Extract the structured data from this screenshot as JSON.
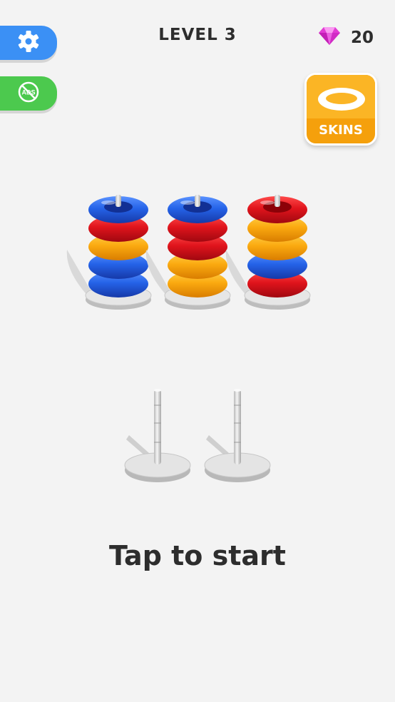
{
  "header": {
    "level": "LEVEL 3",
    "gem_count": "20",
    "gem_icon": "gem-icon"
  },
  "side_buttons": {
    "settings_icon": "gear-icon",
    "no_ads_icon": "no-ads-icon",
    "no_ads_text": "ADS"
  },
  "skins_button": {
    "label": "SKINS",
    "icon": "ring-icon"
  },
  "colors": {
    "blue": "#2563e8",
    "red": "#e0141c",
    "yellow": "#fbaa10",
    "settings_button": "#3b90f5",
    "no_ads_button": "#4cc94e",
    "skins_button": "#f5a00c"
  },
  "towers": [
    {
      "rings": [
        "blue",
        "blue",
        "yellow",
        "red",
        "blue"
      ]
    },
    {
      "rings": [
        "yellow",
        "yellow",
        "red",
        "red",
        "blue"
      ]
    },
    {
      "rings": [
        "red",
        "blue",
        "yellow",
        "yellow",
        "red"
      ]
    }
  ],
  "empty_pegs": 2,
  "prompt": "Tap to start"
}
